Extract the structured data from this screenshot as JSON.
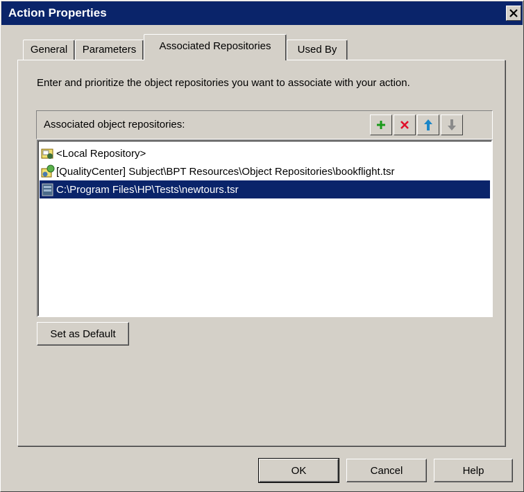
{
  "window": {
    "title": "Action Properties"
  },
  "tabs": [
    {
      "label": "General"
    },
    {
      "label": "Parameters"
    },
    {
      "label": "Associated Repositories"
    },
    {
      "label": "Used By"
    }
  ],
  "active_tab": "Associated Repositories",
  "instruction": "Enter and prioritize the object repositories you want to associate with your action.",
  "repositories": {
    "header_label": "Associated object repositories:",
    "toolbar": {
      "add_icon": "plus-icon",
      "remove_icon": "delete-x-icon",
      "up_icon": "arrow-up-icon",
      "down_icon": "arrow-down-icon"
    },
    "items": [
      {
        "label": "<Local Repository>",
        "icon": "local-repository-icon",
        "selected": false
      },
      {
        "label": "[QualityCenter] Subject\\BPT Resources\\Object Repositories\\bookflight.tsr",
        "icon": "qc-repository-icon",
        "selected": false
      },
      {
        "label": "C:\\Program Files\\HP\\Tests\\newtours.tsr",
        "icon": "file-repository-icon",
        "selected": true
      }
    ]
  },
  "set_default_label": "Set as Default",
  "buttons": {
    "ok": "OK",
    "cancel": "Cancel",
    "help": "Help"
  },
  "colors": {
    "titlebar": "#0a246a",
    "face": "#d4d0c8",
    "selection": "#0a246a"
  }
}
